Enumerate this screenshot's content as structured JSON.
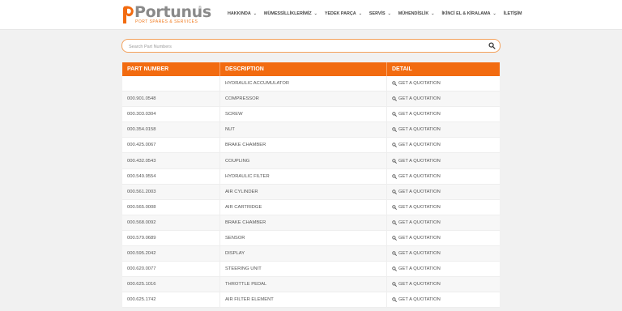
{
  "brand": {
    "name": "Portunus",
    "reg": "®",
    "tagline": "PORT SPARES & SERVICES",
    "accent": "#f26b10"
  },
  "nav": [
    {
      "label": "HAKKINDA",
      "dropdown": true
    },
    {
      "label": "MÜMESSİLLİKLERİMİZ",
      "dropdown": true
    },
    {
      "label": "YEDEK PARÇA",
      "dropdown": true
    },
    {
      "label": "SERVİS",
      "dropdown": true
    },
    {
      "label": "MÜHENDİSLİK",
      "dropdown": true
    },
    {
      "label": "İKİNCİ EL & KİRALAMA",
      "dropdown": true
    },
    {
      "label": "İLETİŞİM",
      "dropdown": false
    }
  ],
  "search": {
    "placeholder": "Search Part Numbers",
    "icon": "search-icon"
  },
  "table": {
    "headers": [
      "PART NUMBER",
      "DESCRIPTION",
      "DETAIL"
    ],
    "action_label": "GET A QUOTATION",
    "rows": [
      {
        "part": "",
        "desc": "HYDRAULIC ACCUMULATOR"
      },
      {
        "part": "000.901.0548",
        "desc": "COMPRESSOR"
      },
      {
        "part": "000.303.0304",
        "desc": "SCREW"
      },
      {
        "part": "000.354.0158",
        "desc": "NUT"
      },
      {
        "part": "000.425.0067",
        "desc": "BRAKE CHAMBER"
      },
      {
        "part": "000.432.0543",
        "desc": "COUPLING"
      },
      {
        "part": "000.549.9554",
        "desc": "HYDRAULIC FILTER"
      },
      {
        "part": "000.561.2003",
        "desc": "AIR CYLINDER"
      },
      {
        "part": "000.565.0008",
        "desc": "AIR CARTRIDGE"
      },
      {
        "part": "000.568.0092",
        "desc": "BRAKE CHAMBER"
      },
      {
        "part": "000.579.0689",
        "desc": "SENSOR"
      },
      {
        "part": "000.595.2042",
        "desc": "DISPLAY"
      },
      {
        "part": "000.620.0077",
        "desc": "STEERING UNIT"
      },
      {
        "part": "000.625.1016",
        "desc": "THROTTLE PEDAL"
      },
      {
        "part": "000.625.1742",
        "desc": "AIR FILTER ELEMENT"
      }
    ]
  }
}
